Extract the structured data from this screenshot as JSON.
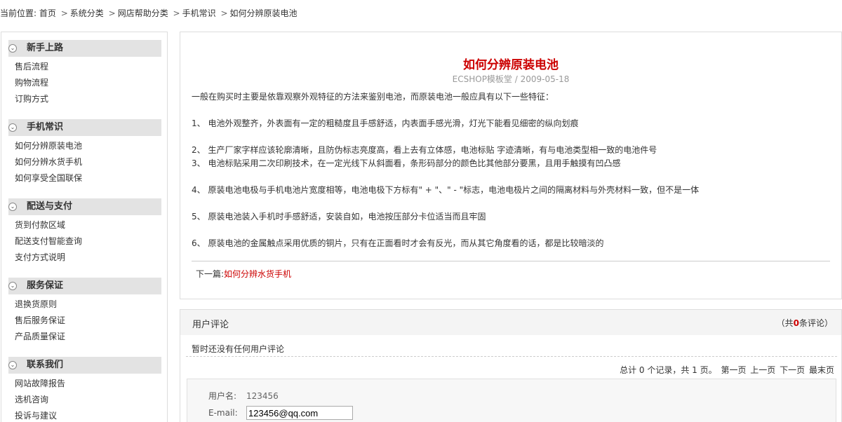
{
  "breadcrumb": {
    "prefix": "当前位置:",
    "items": [
      "首页",
      "系统分类",
      "网店帮助分类",
      "手机常识",
      "如何分辨原装电池"
    ],
    "separator": ">"
  },
  "sidebar": {
    "categories": [
      {
        "title": "新手上路",
        "items": [
          "售后流程",
          "购物流程",
          "订购方式"
        ]
      },
      {
        "title": "手机常识",
        "items": [
          "如何分辨原装电池",
          "如何分辨水货手机",
          "如何享受全国联保"
        ]
      },
      {
        "title": "配送与支付",
        "items": [
          "货到付款区域",
          "配送支付智能查询",
          "支付方式说明"
        ]
      },
      {
        "title": "服务保证",
        "items": [
          "退换货原则",
          "售后服务保证",
          "产品质量保证"
        ]
      },
      {
        "title": "联系我们",
        "items": [
          "网站故障报告",
          "选机咨询",
          "投诉与建议"
        ]
      }
    ]
  },
  "article": {
    "title": "如何分辨原装电池",
    "meta": "ECSHOP模板堂 / 2009-05-18",
    "paragraphs": [
      "一般在购买时主要是依靠观察外观特征的方法来鉴别电池，而原装电池一般应具有以下一些特征：",
      "1、 电池外观整齐，外表面有一定的粗糙度且手感舒适，内表面手感光滑，灯光下能看见细密的纵向划痕",
      "2、 生产厂家字样应该轮廓清晰，且防伪标志亮度高，看上去有立体感，电池标贴 字迹清晰，有与电池类型相一致的电池件号",
      "3、 电池标贴采用二次印刷技术，在一定光线下从斜面看，条形码部分的颜色比其他部分要黑，且用手触摸有凹凸感",
      "4、 原装电池电极与手机电池片宽度相等，电池电极下方标有\" + \"、\" - \"标志，电池电极片之间的隔离材料与外壳材料一致，但不是一体",
      "5、 原装电池装入手机时手感舒适，安装自如，电池按压部分卡位适当而且牢固",
      "6、 原装电池的金属触点采用优质的铜片，只有在正面看时才会有反光，而从其它角度看的话，都是比较暗淡的"
    ],
    "next_label": "下一篇:",
    "next_link": "如何分辨水货手机"
  },
  "comments": {
    "title": "用户评论",
    "count_prefix": "（共",
    "count": "0",
    "count_suffix": "条评论）",
    "empty_text": "暂时还没有任何用户评论",
    "pager": {
      "summary": "总计 0 个记录，共 1 页。",
      "first": "第一页",
      "prev": "上一页",
      "next": "下一页",
      "last": "最末页"
    },
    "form": {
      "username_label": "用户名:",
      "username_value": "123456",
      "email_label": "E-mail:",
      "email_value": "123456@qq.com"
    }
  }
}
